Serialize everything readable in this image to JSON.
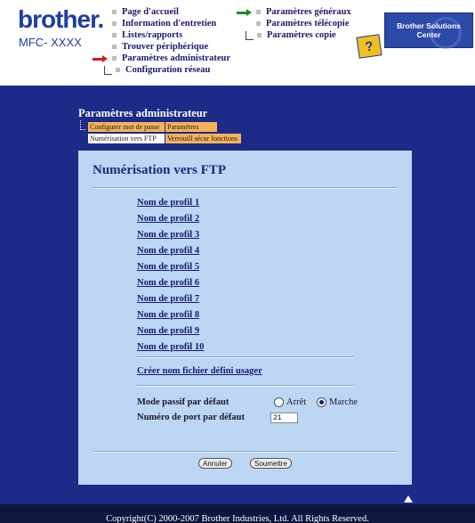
{
  "header": {
    "brand": "brother.",
    "model": "MFC- XXXX",
    "solutions_center": "Brother Solutions Center",
    "help_glyph": "?",
    "nav_left": [
      {
        "label": "Page d'accueil",
        "icon": "bullet"
      },
      {
        "label": "Information d'entretien",
        "icon": "bullet"
      },
      {
        "label": "Listes/rapports",
        "icon": "bullet"
      },
      {
        "label": "Trouver périphérique",
        "icon": "bullet"
      },
      {
        "label": "Paramètres administrateur",
        "icon": "red-arrow-icon"
      },
      {
        "label": "Configuration réseau",
        "icon": "tree-bullet"
      }
    ],
    "nav_right": [
      {
        "label": "Paramètres généraux",
        "icon": "green-arrow-icon"
      },
      {
        "label": "Paramètres télécopie",
        "icon": "bullet"
      },
      {
        "label": "Paramètres copie",
        "icon": "tree-bullet"
      }
    ]
  },
  "section": {
    "title": "Paramètres administrateur",
    "tabs": [
      {
        "label": "Configurer mot de passe"
      },
      {
        "label": "Paramètres WEB"
      },
      {
        "label": "Numérisation vers FTP"
      },
      {
        "label": "Verrouill sécur fonctions"
      }
    ]
  },
  "panel": {
    "title": "Numérisation vers FTP",
    "profiles": [
      "Nom de profil 1",
      "Nom de profil 2",
      "Nom de profil 3",
      "Nom de profil 4",
      "Nom de profil 5",
      "Nom de profil 6",
      "Nom de profil 7",
      "Nom de profil 8",
      "Nom de profil 9",
      "Nom de profil 10"
    ],
    "create_link": "Créer nom fichier défini usager",
    "passive_mode": {
      "label": "Mode passif par défaut",
      "options": [
        "Arrêt",
        "Marche"
      ],
      "selected": "Marche"
    },
    "port": {
      "label": "Numéro de port par défaut",
      "value": "21"
    },
    "buttons": {
      "cancel": "Annuler",
      "submit": "Soumettre"
    }
  },
  "footer": {
    "copyright": "Copyright(C) 2000-2007 Brother Industries, Ltd. All Rights Reserved."
  },
  "colors": {
    "background_main": "#1c2a88",
    "panel": "#bcd6f4",
    "tab_orange": "#f4b35a",
    "brand_blue": "#1f3ea1"
  }
}
